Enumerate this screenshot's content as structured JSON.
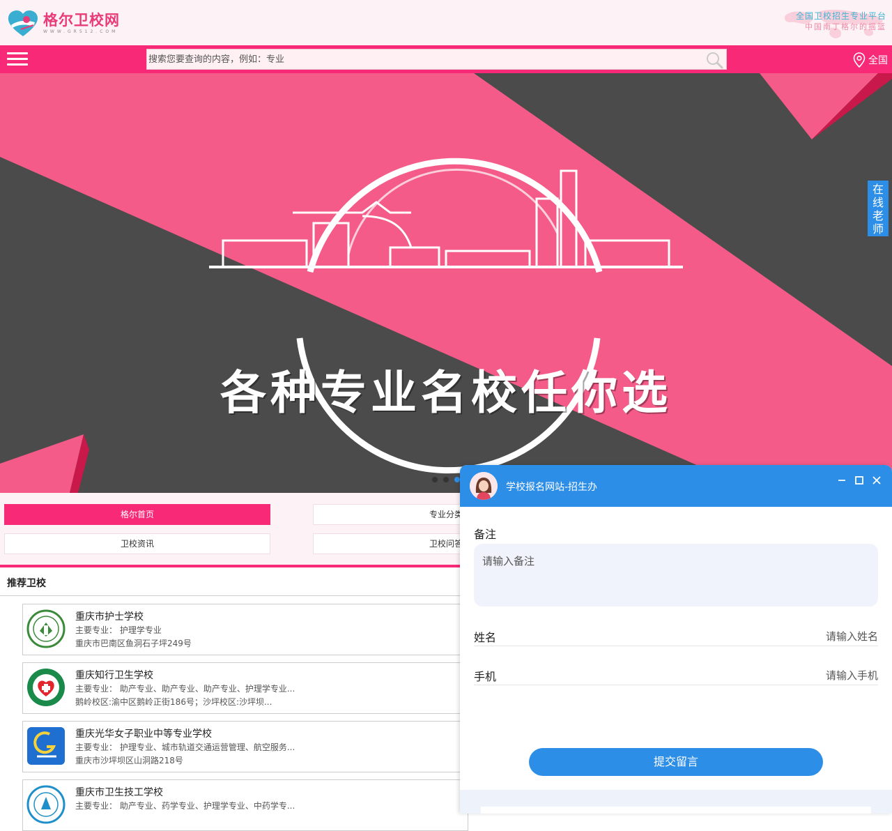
{
  "header": {
    "logo_title": "格尔卫校网",
    "logo_sub": "WWW.GR512.COM",
    "slogan_line1": "全国卫校招生专业平台",
    "slogan_line2": "中国南丁格尔的摇篮"
  },
  "navbar": {
    "search_placeholder": "搜索您要查询的内容，例如：专业",
    "region": "全国"
  },
  "banner": {
    "title": "各种专业名校任你选",
    "dots": 3,
    "active_dot": 2
  },
  "side_tab": {
    "label": [
      "在",
      "线",
      "老",
      "师"
    ]
  },
  "quicknav": {
    "items": [
      {
        "label": "格尔首页",
        "active": true
      },
      {
        "label": "专业分类",
        "active": false
      },
      {
        "label": "卫校资讯",
        "active": false
      },
      {
        "label": "卫校问答",
        "active": false
      }
    ]
  },
  "schools": {
    "section_title": "推荐卫校",
    "items": [
      {
        "name": "重庆市护士学校",
        "major": "主要专业：  护理学专业",
        "address": "重庆市巴南区鱼洞石子坪249号"
      },
      {
        "name": "重庆知行卫生学校",
        "major": "主要专业：  助产专业、助产专业、助产专业、护理学专业...",
        "address": "鹅岭校区:渝中区鹅岭正街186号；沙坪校区:沙坪坝..."
      },
      {
        "name": "重庆光华女子职业中等专业学校",
        "major": "主要专业：  护理专业、城市轨道交通运营管理、航空服务...",
        "address": "重庆市沙坪坝区山洞路218号"
      },
      {
        "name": "重庆市卫生技工学校",
        "major": "主要专业：  助产专业、药学专业、护理学专业、中药学专...",
        "address": ""
      }
    ]
  },
  "chat": {
    "title": "学校报名网站-招生办",
    "note_label": "备注",
    "note_placeholder": "请输入备注",
    "name_label": "姓名",
    "name_placeholder": "请输入姓名",
    "phone_label": "手机",
    "phone_placeholder": "请输入手机",
    "submit_label": "提交留言"
  },
  "colors": {
    "brand_pink": "#f82a78",
    "accent_blue": "#2d8ee8",
    "banner_gray": "#4b4b4b",
    "banner_pink": "#f45b88"
  }
}
